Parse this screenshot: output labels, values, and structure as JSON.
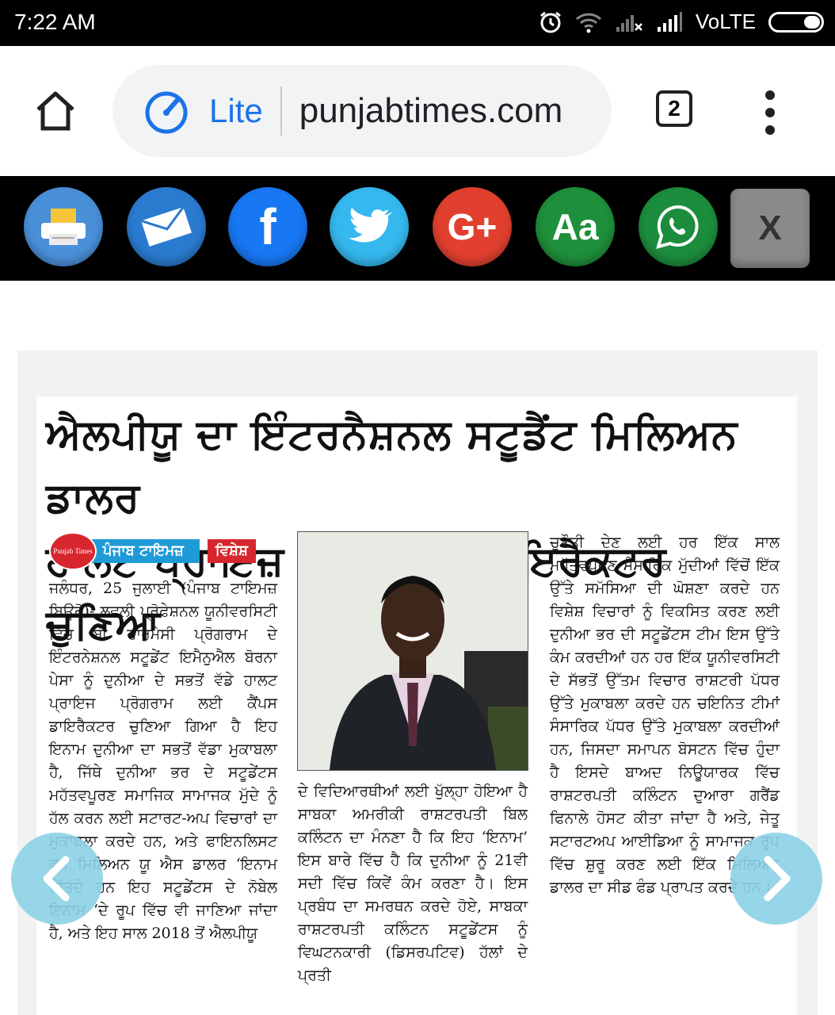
{
  "status_bar": {
    "time": "7:22 AM",
    "network_label": "VoLTE",
    "icons": [
      "alarm-icon",
      "wifi-icon",
      "no-signal-icon",
      "signal-icon",
      "battery-icon"
    ]
  },
  "browser": {
    "mode_label": "Lite",
    "url": "punjabtimes.com",
    "tab_count": "2",
    "accent_color": "#1a73e8"
  },
  "share_bar": {
    "buttons": [
      {
        "name": "print",
        "label": "",
        "color": "#4a90d9"
      },
      {
        "name": "email",
        "label": "",
        "color": "#2a7bd0"
      },
      {
        "name": "facebook",
        "label": "f",
        "color": "#1877f2"
      },
      {
        "name": "twitter",
        "label": "",
        "color": "#35b8ee"
      },
      {
        "name": "google-plus",
        "label": "G+",
        "color": "#e2402f"
      },
      {
        "name": "font-size",
        "label": "Aa",
        "color": "#1e8f3a"
      },
      {
        "name": "whatsapp",
        "label": "",
        "color": "#1c8d3c"
      }
    ],
    "close_label": "X"
  },
  "article": {
    "headline_line1": "ਐਲਪੀਯੂ ਦਾ ਇੰਟਰਨੈਸ਼ਨਲ ਸਟੂਡੈਂਟ ਮਿਲਿਅਨ ਡਾਲਰ",
    "headline_line2": "ਹਾਲਟ ਪ੍ਰਾਇਜ਼ ਲਈ ਕੈਂਪਸ ਡਾਇਰੈਕਟਰ ਚੁਣਿਆ",
    "brand_logo_text": "Punjab Times",
    "brand_name": "ਪੰਜਾਬ ਟਾਇਮਜ਼",
    "brand_tag": "ਵਿਸ਼ੇਸ਼",
    "column1": "ਜਲੰਧਰ, 25 ਜੁਲਾਈ (ਪੰਜਾਬ ਟਾਇਮਜ਼ ਬਿਊਰੋ)- ਲਵਲੀ ਪ੍ਰੋਫੇਸ਼ਨਲ ਯੂਨੀਵਰਸਿਟੀ ਵਿੱਚ ਬੀ ਫਾਰਮੇਸੀ ਪ੍ਰੋਗਰਾਮ ਦੇ ਇੰਟਰਨੇਸ਼ਨਲ ਸਟੂਡੇਂਟ ਇਮੈਨੁਐਲ ਬੋਰਨਾ ਪੇਸਾ ਨੂੰ ਦੁਨੀਆ ਦੇ ਸਭਤੋਂ ਵੱਡੇ ਹਾਲਟ ਪ੍ਰਾਇਜ ਪ੍ਰੋਗਰਾਮ ਲਈ ਕੈਂਪਸ ਡਾਇਰੈਕਟਰ ਚੁਣਿਆ ਗਿਆ ਹੈ ਇਹ ਇਨਾਮ ਦੁਨੀਆ ਦਾ ਸਭਤੋਂ ਵੱਡਾ ਮੁਕਾਬਲਾ ਹੈ, ਜਿੱਥੇ ਦੁਨੀਆ ਭਰ ਦੇ ਸਟੂਡੇਂਟਸ ਮਹੱਤਵਪੂਰਣ ਸਮਾਜਿਕ ਸਾਮਾਜਕ ਮੁੱਦੇ ਨੂੰ ਹੱਲ ਕਰਨ ਲਈ ਸਟਾਰਟ-ਅਪ ਵਿਚਾਰਾਂ ਦਾ ਮੁਕਾਬਲਾ ਕਰਦੇ ਹਨ, ਅਤੇ ਫਾਇਨਲਿਸਟ ਵਨ ਮਿਲਿਅਨ ਯੂ ਐਸ ਡਾਲਰ ‘ਇਨਾਮ ਜਿੱਤਦੇ ਹਨ ਇਹ ਸਟੂਡੇਂਟਸ ਦੇ ਨੋਬੇਲ ਇਨਾਮ ‘ਦੇ ਰੂਪ ਵਿੱਚ ਵੀ ਜਾਣਿਆ ਜਾਂਦਾ ਹੈ, ਅਤੇ ਇਹ ਸਾਲ 2018 ਤੋਂ ਐਲਪੀਯੂ",
    "column2": "ਦੇ ਵਿਦਿਆਰਥੀਆਂ ਲਈ ਖੁੱਲ੍ਹਾ ਹੋਇਆ ਹੈ ਸਾਬਕਾ ਅਮਰੀਕੀ ਰਾਸ਼ਟਰਪਤੀ ਬਿਲ ਕਲਿੰਟਨ ਦਾ ਮੰਨਣਾ ਹੈ ਕਿ ਇਹ ‘ਇਨਾਮ’ ਇਸ ਬਾਰੇ ਵਿੱਚ ਹੈ ਕਿ ਦੁਨੀਆ ਨੂੰ 21ਵੀ ਸਦੀ ਵਿੱਚ ਕਿਵੇਂ ਕੰਮ ਕਰਣਾ ਹੈ। ਇਸ ਪ੍ਰਬੰਧ ਦਾ ਸਮਰਥਨ ਕਰਦੇ ਹੋਏ, ਸਾਬਕਾ ਰਾਸ਼ਟਰਪਤੀ ਕਲਿੰਟਨ ਸਟੂਡੇਂਟਸ ਨੂੰ ਵਿਘਟਨਕਾਰੀ (ਡਿਸਰਪਟਿਵ) ਹੱਲਾਂ ਦੇ ਪ੍ਰਤੀ",
    "column3": "ਚੁਣੌਤੀ ਦੇਣ ਲਈ ਹਰ ਇੱਕ ਸਾਲ ਮਹੱਤਵਪੂਰਣ ਸੰਸਾਰਿਕ ਮੁੱਦੀਆਂ ਵਿੱਚੋਂ ਇੱਕ ਉੱਤੇ ਸਮੱਸਿਆ ਦੀ ਘੋਸ਼ਣਾ ਕਰਦੇ ਹਨ ਵਿਸ਼ੇਸ਼ ਵਿਚਾਰਾਂ ਨੂੰ ਵਿਕਸਿਤ ਕਰਣ ਲਈ ਦੁਨੀਆ ਭਰ ਦੀ ਸਟੂਡੇਂਟਸ ਟੀਮ ਇਸ ਉੱਤੇ ਕੰਮ ਕਰਦੀਆਂ ਹਨ ਹਰ ਇੱਕ ਯੂਨੀਵਰਸਿਟੀ ਦੇ ਸੱਭਤੋਂ ਉੱਤਮ ਵਿਚਾਰ ਰਾਸ਼ਟਰੀ ਪੱਧਰ ਉੱਤੇ ਮੁਕਾਬਲਾ ਕਰਦੇ ਹਨ ਚਇਨਿਤ ਟੀਮਾਂ ਸੰਸਾਰਿਕ ਪੱਧਰ ਉੱਤੇ ਮੁਕਾਬਲਾ ਕਰਦੀਆਂ ਹਨ, ਜਿਸਦਾ ਸਮਾਪਨ ਬੋਸਟਨ ਵਿੱਚ ਹੁੰਦਾ ਹੈ ਇਸਦੇ ਬਾਅਦ ਨਿਊਯਾਰਕ ਵਿੱਚ ਰਾਸ਼ਟਰਪਤੀ ਕਲਿੰਟਨ ਦੁਆਰਾ ਗਰੈਂਡ ਫਿਨਾਲੇ ਹੋਸਟ ਕੀਤਾ ਜਾਂਦਾ ਹੈ ਅਤੇ, ਜੇਤੂ ਸਟਾਰਟਅਪ ਆਈਡਿਆ ਨੂੰ ਸਾਮਾਜਕ ਰੂਪ ਵਿੱਚ ਸ਼ੁਰੂ ਕਰਣ ਲਈ ਇੱਕ ਮਿਲਿਅਨ ਡਾਲਰ ਦਾ ਸੀਡ ਫੰਡ ਪ੍ਰਾਪਤ ਕਰਦੇ ਹਨ।"
  }
}
